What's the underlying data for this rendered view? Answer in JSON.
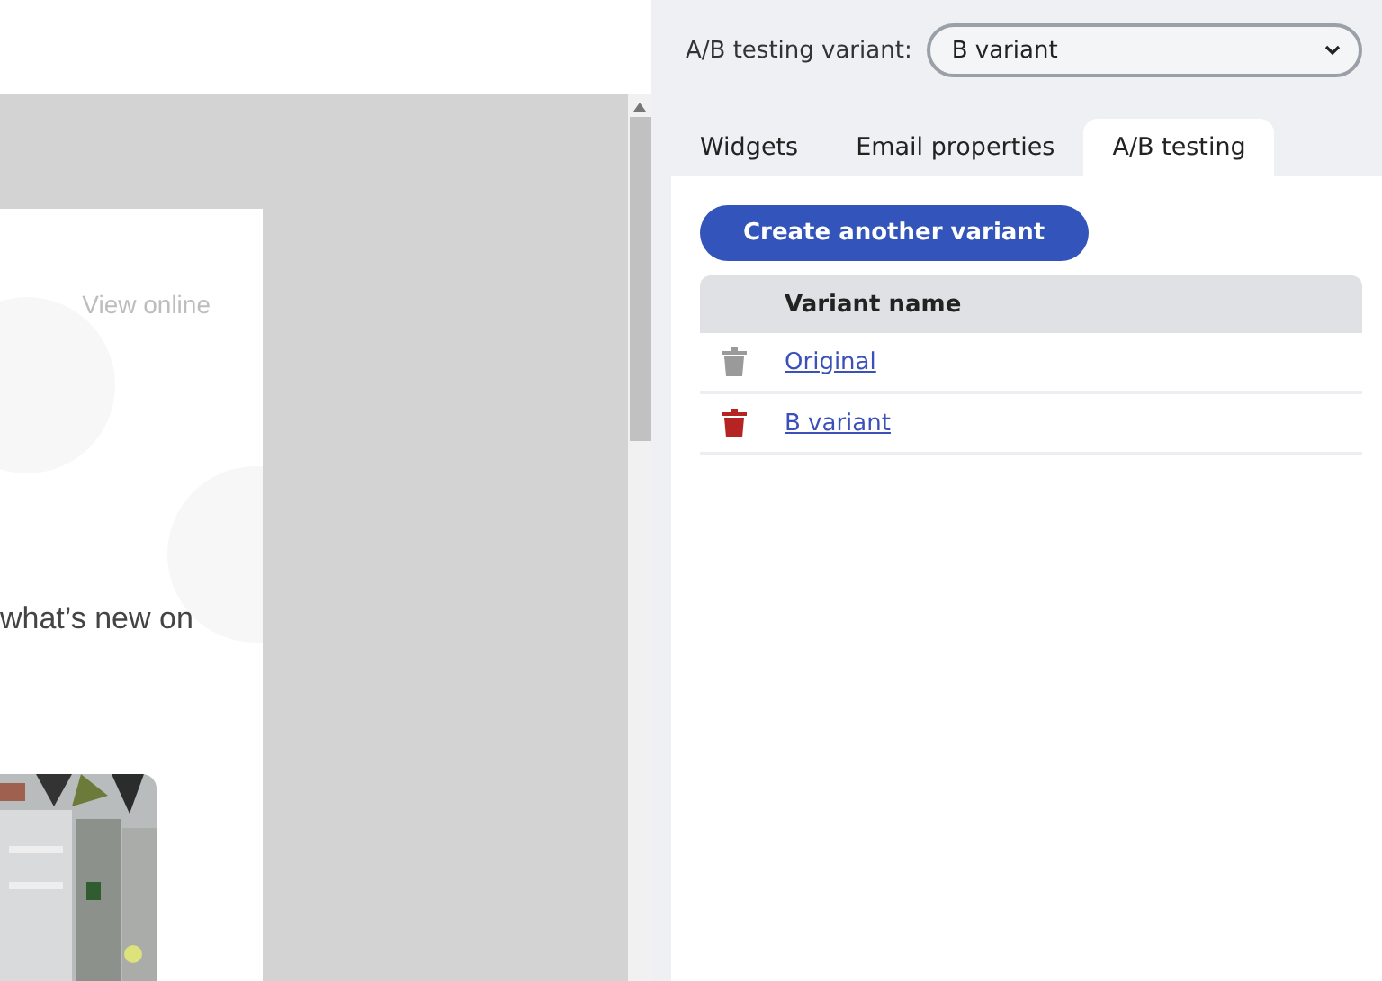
{
  "email_preview": {
    "view_online": "View online",
    "body_text": "what’s new on"
  },
  "variant_selector": {
    "label": "A/B testing variant:",
    "value": "B variant"
  },
  "tabs": [
    {
      "label": "Widgets",
      "selected": false
    },
    {
      "label": "Email properties",
      "selected": false
    },
    {
      "label": "A/B testing",
      "selected": true
    }
  ],
  "create_button": "Create another variant",
  "table": {
    "columns": [
      "Variant name"
    ],
    "rows": [
      {
        "name": "Original",
        "delete_disabled": true
      },
      {
        "name": "B variant",
        "delete_disabled": false
      }
    ]
  }
}
